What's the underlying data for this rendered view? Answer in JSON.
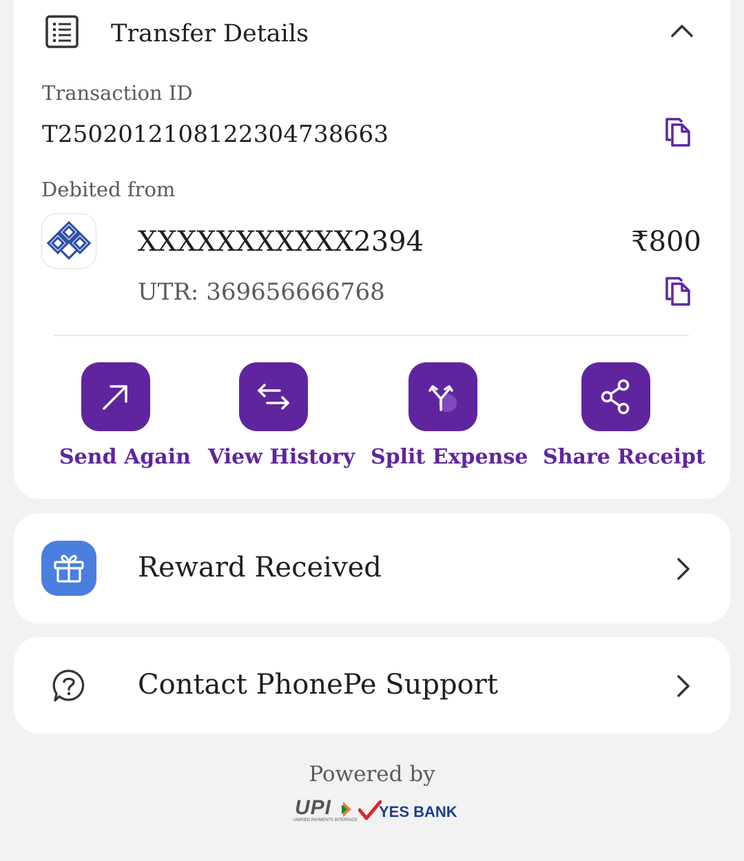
{
  "transfer_details": {
    "title": "Transfer Details",
    "transaction_id_label": "Transaction ID",
    "transaction_id": "T2502012108122304738663",
    "debited_from_label": "Debited from",
    "account_number": "XXXXXXXXXXX2394",
    "amount": "₹800",
    "utr": "UTR: 369656666768"
  },
  "actions": [
    {
      "label": "Send Again",
      "icon": "arrow-up-right-icon"
    },
    {
      "label": "View History",
      "icon": "swap-arrows-icon"
    },
    {
      "label": "Split Expense",
      "icon": "split-icon"
    },
    {
      "label": "Share Receipt",
      "icon": "share-icon"
    }
  ],
  "reward": {
    "title": "Reward Received",
    "icon": "gift-icon"
  },
  "support": {
    "title": "Contact PhonePe Support",
    "icon": "help-icon"
  },
  "footer": {
    "powered_by": "Powered by",
    "upi_logo_text": "UPI",
    "upi_tagline": "UNIFIED PAYMENTS INTERFACE",
    "bank_logo_text": "YES BANK"
  },
  "colors": {
    "brand_purple": "#5f259f",
    "reward_blue": "#4a7fe0",
    "background": "#f2f2f2"
  }
}
